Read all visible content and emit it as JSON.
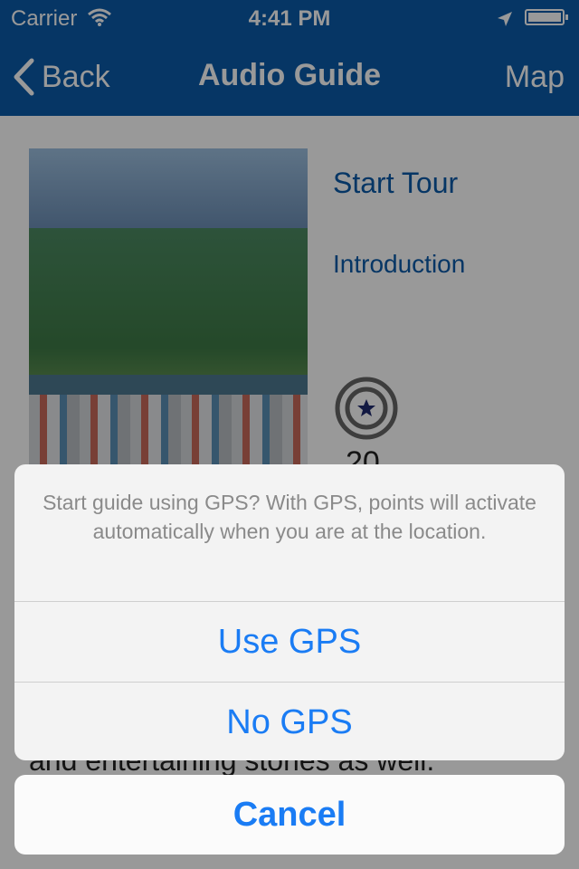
{
  "status_bar": {
    "carrier": "Carrier",
    "time": "4:41 PM"
  },
  "nav": {
    "back_label": "Back",
    "title": "Audio Guide",
    "right_label": "Map",
    "bar_color": "#0b5aa8"
  },
  "content": {
    "links": {
      "start_tour": "Start Tour",
      "introduction": "Introduction"
    },
    "point_count": "20",
    "description_fragment": "and entertaining stories as well."
  },
  "action_sheet": {
    "message": "Start guide using GPS? With GPS, points will activate automatically when you are at the location.",
    "options": [
      "Use GPS",
      "No GPS"
    ],
    "cancel_label": "Cancel",
    "accent_color": "#1a7cf4"
  },
  "icons": [
    "wifi-icon",
    "location-arrow-icon",
    "battery-icon",
    "back-chevron-icon",
    "target-star-icon"
  ]
}
